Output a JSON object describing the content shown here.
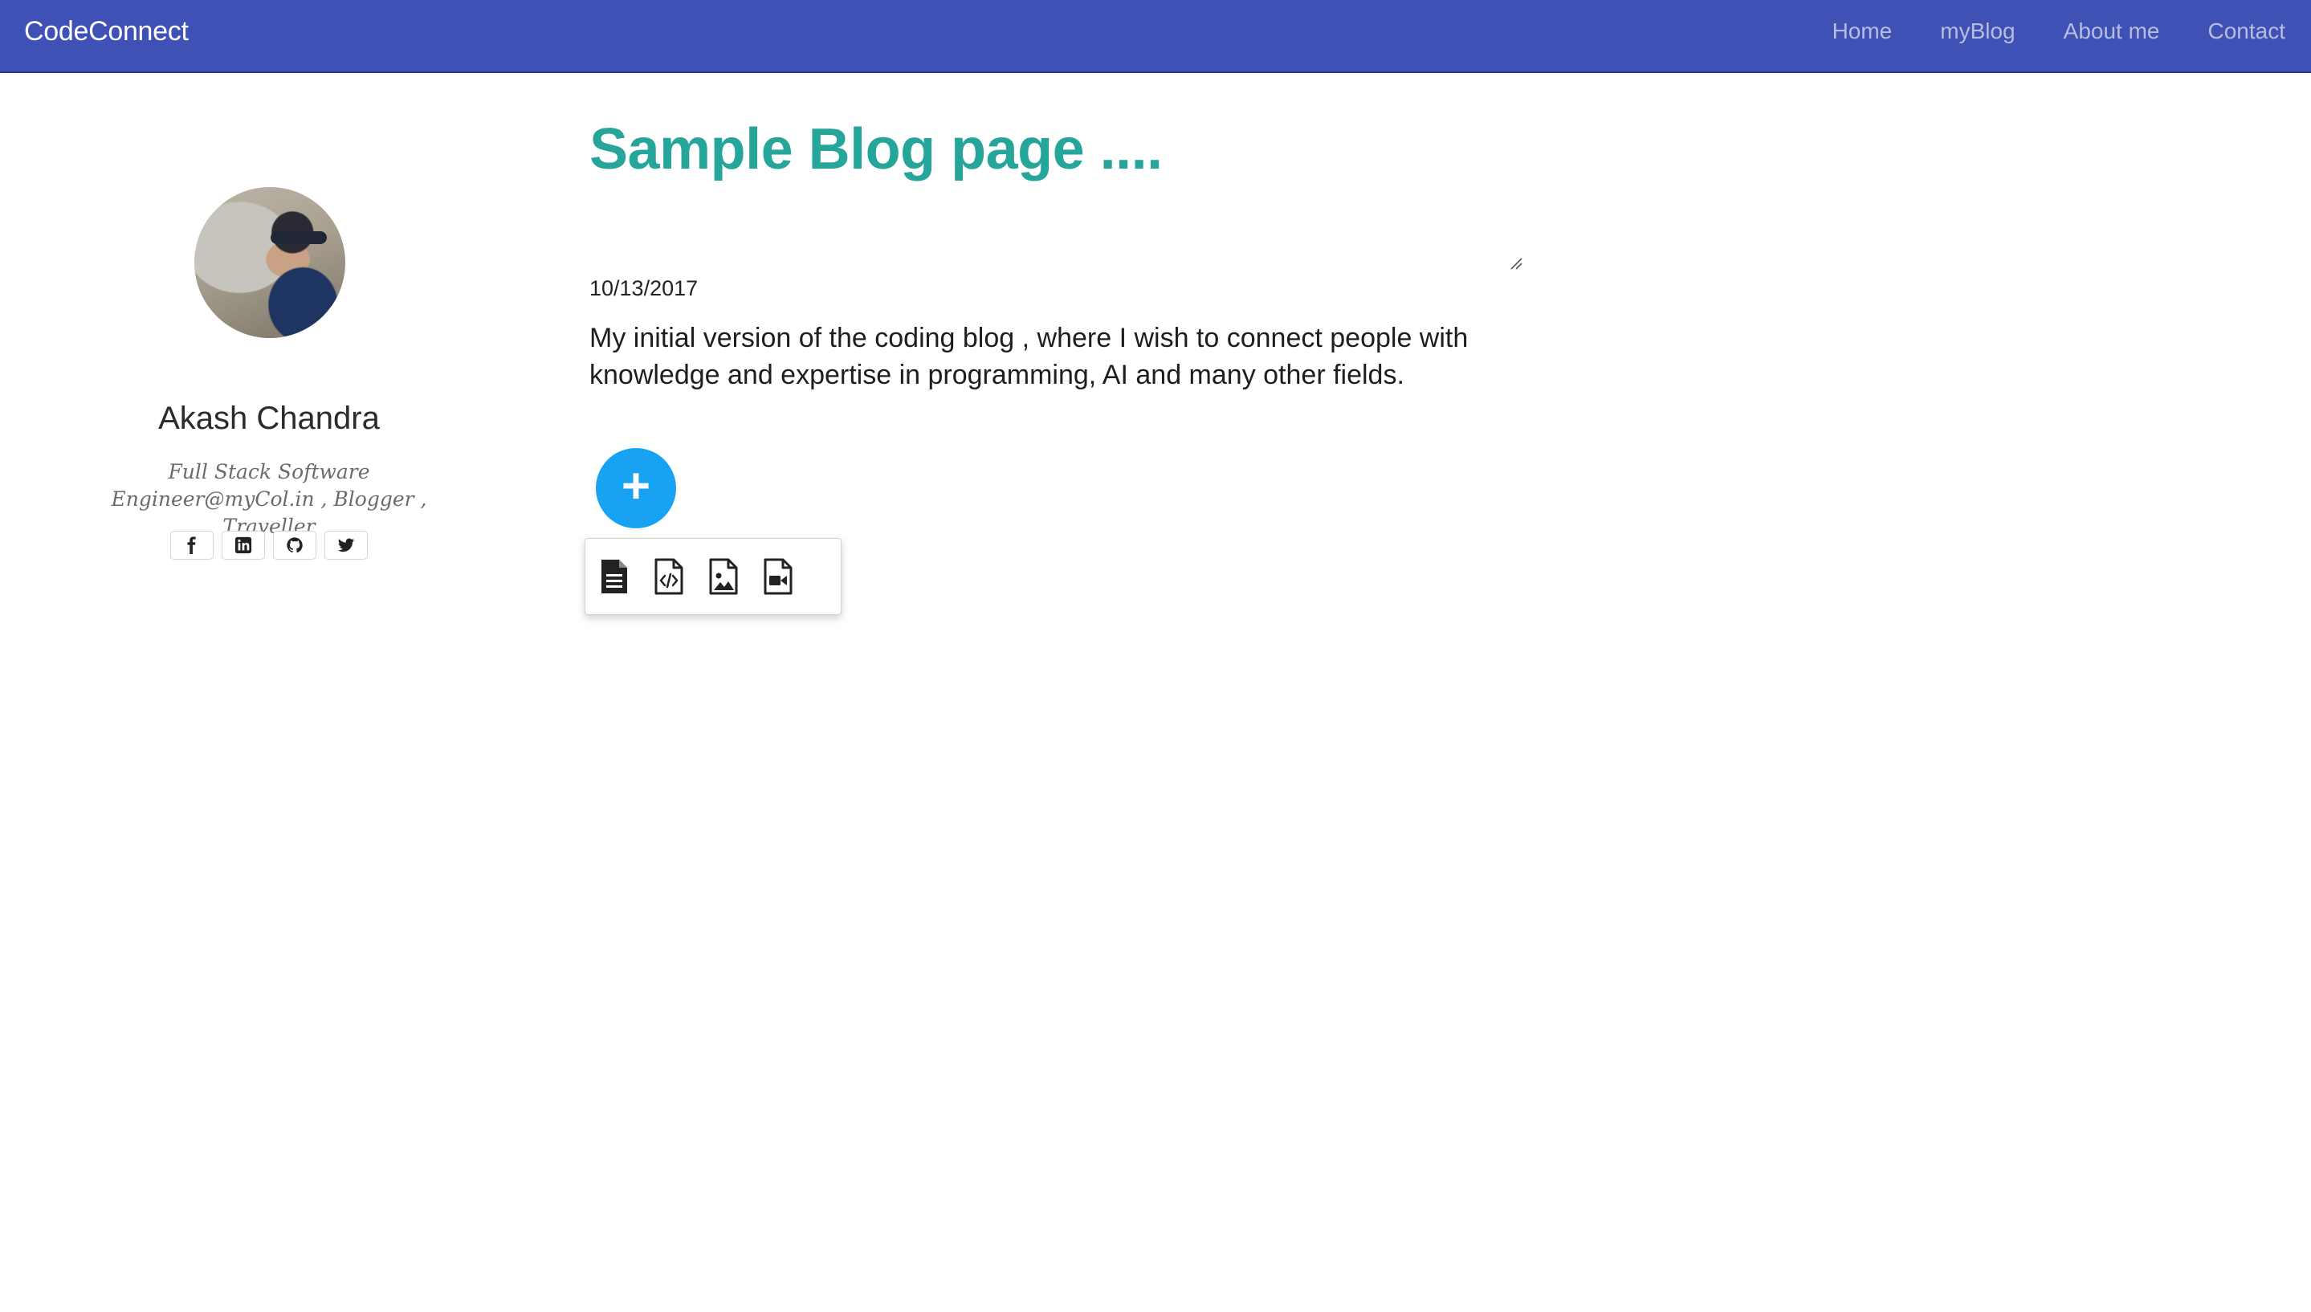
{
  "navbar": {
    "brand": "CodeConnect",
    "links": [
      "Home",
      "myBlog",
      "About me",
      "Contact"
    ],
    "background": "#3f51b5"
  },
  "profile": {
    "name": "Akash Chandra",
    "bio": "Full Stack Software Engineer@myCol.in , Blogger , Traveller",
    "social_icons": [
      "facebook-icon",
      "linkedin-icon",
      "github-icon",
      "twitter-icon"
    ]
  },
  "blog": {
    "title": "Sample Blog page ....",
    "date": "10/13/2017",
    "content": "My initial version of the coding blog , where I wish to connect people with knowledge and expertise in programming, AI and many other fields.",
    "title_color": "#26a69a"
  },
  "fab": {
    "label": "+",
    "color": "#17a2f2"
  },
  "tool_menu": {
    "icons": [
      "text-document-icon",
      "code-file-icon",
      "image-file-icon",
      "video-file-icon"
    ]
  }
}
